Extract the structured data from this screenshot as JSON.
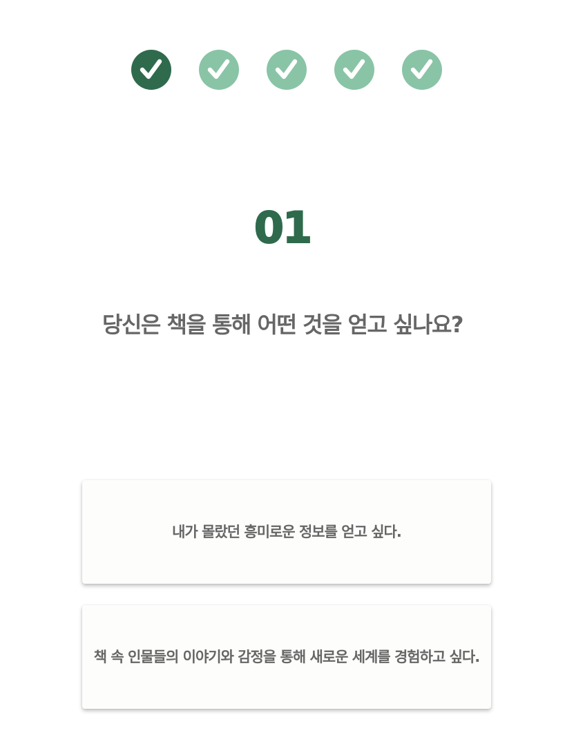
{
  "progress": {
    "steps": [
      {
        "state": "current",
        "icon": "check-icon"
      },
      {
        "state": "pending",
        "icon": "check-icon"
      },
      {
        "state": "pending",
        "icon": "check-icon"
      },
      {
        "state": "pending",
        "icon": "check-icon"
      },
      {
        "state": "pending",
        "icon": "check-icon"
      }
    ],
    "colors": {
      "current": "#2f6a4d",
      "pending": "#89c4a6"
    }
  },
  "question": {
    "number": "01",
    "text": "당신은 책을 통해 어떤 것을 얻고 싶나요?"
  },
  "answers": [
    {
      "label": "내가 몰랐던 흥미로운 정보를 얻고 싶다."
    },
    {
      "label": "책 속 인물들의 이야기와 감정을 통해 새로운 세계를 경험하고 싶다."
    }
  ]
}
